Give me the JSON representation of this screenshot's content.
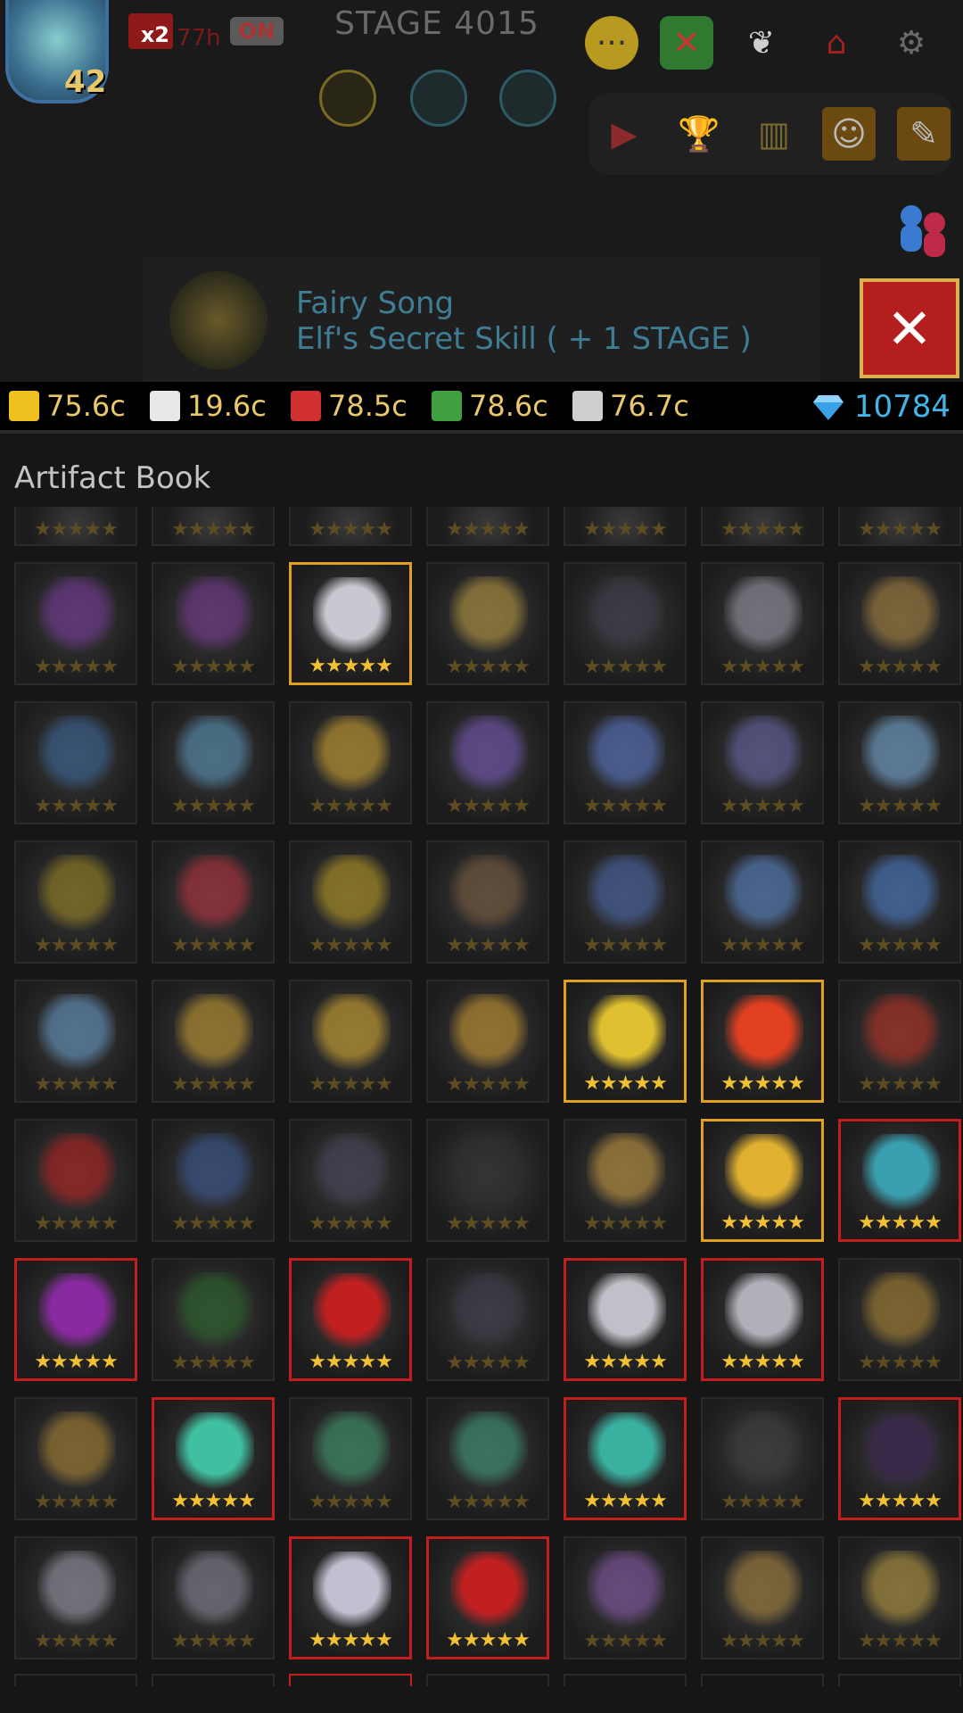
{
  "header": {
    "hero_level": "42",
    "speed_multiplier": "x2",
    "speed_time": "77h",
    "speed_status": "ON",
    "stage": "STAGE 4015"
  },
  "banner": {
    "title": "Fairy Song",
    "subtitle": "Elf's Secret Skill ( + 1 STAGE )",
    "close_label": "✕"
  },
  "resources": [
    {
      "name": "crown",
      "value": "75.6c",
      "color": "#f0c020"
    },
    {
      "name": "horn",
      "value": "19.6c",
      "color": "#e8e8e8"
    },
    {
      "name": "fruit",
      "value": "78.5c",
      "color": "#d03030"
    },
    {
      "name": "vine",
      "value": "78.6c",
      "color": "#40a040"
    },
    {
      "name": "feather",
      "value": "76.7c",
      "color": "#cfcfcf"
    }
  ],
  "gems": "10784",
  "section_title": "Artifact Book",
  "stars": "★★★★★",
  "grid": [
    [
      "n",
      "n",
      "n",
      "n",
      "n",
      "n",
      "n"
    ],
    [
      "n",
      "n",
      "gold",
      "n",
      "n",
      "n",
      "n"
    ],
    [
      "n",
      "n",
      "n",
      "n",
      "n",
      "n",
      "n"
    ],
    [
      "n",
      "n",
      "n",
      "n",
      "n",
      "n",
      "n"
    ],
    [
      "n",
      "n",
      "n",
      "n",
      "gold",
      "gold",
      "n"
    ],
    [
      "n",
      "n",
      "n",
      "n",
      "n",
      "gold",
      "red"
    ],
    [
      "red",
      "n",
      "red",
      "n",
      "red",
      "red",
      "n"
    ],
    [
      "n",
      "red",
      "n",
      "n",
      "red",
      "n",
      "red"
    ],
    [
      "n",
      "n",
      "red",
      "red",
      "n",
      "n",
      "n"
    ]
  ],
  "art_colors": [
    [
      "#6a4a8a",
      "#3a5a9a",
      "#3a4a8a",
      "#4a5a7a",
      "#3a3a7a",
      "#5a4a8a",
      "#6a4a9a"
    ],
    [
      "#7a3aa0",
      "#7a3a9a",
      "#c8c8d0",
      "#c0a040",
      "#404050",
      "#a0a0b0",
      "#b08840"
    ],
    [
      "#3a6aa0",
      "#5a9ac0",
      "#d8a830",
      "#7a5ac0",
      "#5a7ad0",
      "#6a6ab0",
      "#7ab0e0"
    ],
    [
      "#a08a20",
      "#c03040",
      "#c0a020",
      "#806040",
      "#4a6ab0",
      "#5a8ad0",
      "#4a80d0"
    ],
    [
      "#6aa0d0",
      "#d0a030",
      "#e0b030",
      "#d8a030",
      "#e0c030",
      "#e04020",
      "#c03020"
    ],
    [
      "#c02020",
      "#3a5a9a",
      "#4a4a60",
      "#303030",
      "#d0a040",
      "#e0b030",
      "#3aa0b0"
    ],
    [
      "#8a2aa0",
      "#2a6a2a",
      "#c02020",
      "#404050",
      "#c0c0c8",
      "#b0b0b8",
      "#b08830"
    ],
    [
      "#b08830",
      "#40c0a0",
      "#40a070",
      "#40a080",
      "#3ab0a0",
      "#404040",
      "#3a2a4a"
    ],
    [
      "#a0a0b0",
      "#8a8a9a",
      "#c0c0d0",
      "#c02020",
      "#8a5ab0",
      "#b08a40",
      "#c0a040"
    ]
  ],
  "bottom_partial": [
    "n",
    "n",
    "red",
    "n",
    "n",
    "n",
    "n"
  ]
}
